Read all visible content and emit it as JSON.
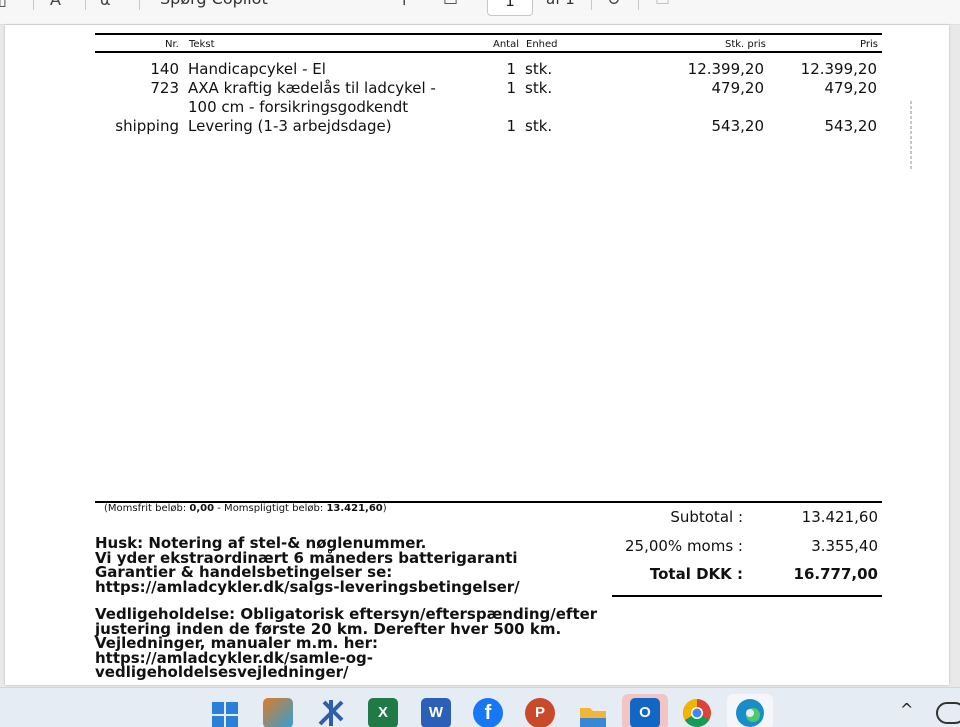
{
  "toolbar": {
    "copilot_label": "Spørg Copilot",
    "page_number": "1",
    "page_of": "af 1",
    "icons": [
      "sidebar-icon",
      "text-icon",
      "read-aloud-icon",
      "draw-icon",
      "fit-page-icon",
      "rotate-icon",
      "page-view-icon"
    ]
  },
  "invoice": {
    "columns": {
      "nr": "Nr.",
      "tekst": "Tekst",
      "antal": "Antal",
      "enhed": "Enhed",
      "stk_pris": "Stk. pris",
      "pris": "Pris"
    },
    "rows": [
      {
        "nr": "140",
        "tekst": "Handicapcykel - El",
        "tekst2": "",
        "antal": "1",
        "enhed": "stk.",
        "stk_pris": "12.399,20",
        "pris": "12.399,20"
      },
      {
        "nr": "723",
        "tekst": "AXA kraftig kædelås til ladcykel -",
        "tekst2": "100 cm - forsikringsgodkendt",
        "antal": "1",
        "enhed": "stk.",
        "stk_pris": "479,20",
        "pris": "479,20"
      },
      {
        "nr": "shipping",
        "tekst": "Levering (1-3 arbejdsdage)",
        "tekst2": "",
        "antal": "1",
        "enhed": "stk.",
        "stk_pris": "543,20",
        "pris": "543,20"
      }
    ],
    "moms_note": {
      "prefix": "(Momsfrit beløb: ",
      "momsfrit": "0,00",
      "middle": " - Momspligtigt beløb: ",
      "momspligtigt": "13.421,60",
      "suffix": ")"
    },
    "totals": {
      "subtotal_label": "Subtotal :",
      "subtotal_value": "13.421,60",
      "moms_label": "25,00% moms :",
      "moms_value": "3.355,40",
      "total_label": "Total DKK :",
      "total_value": "16.777,00"
    },
    "notes1": [
      "Husk: Notering af stel-& nøglenummer.",
      "Vi yder ekstraordinært 6 måneders batterigaranti",
      "Garantier & handelsbetingelser se:",
      "https://amladcykler.dk/salgs-leveringsbetingelser/"
    ],
    "notes2": [
      "Vedligeholdelse: Obligatorisk eftersyn/efterspænding/efter",
      "justering inden de første 20 km. Derefter hver 500 km.",
      "Vejledninger, manualer m.m. her:",
      "https://amladcykler.dk/samle-og-",
      "vedligeholdelsesvejledninger/"
    ]
  },
  "taskbar": {
    "apps": [
      {
        "name": "start-icon",
        "color": "#2a7fd9"
      },
      {
        "name": "paint-app-icon",
        "color": "#e07a26"
      },
      {
        "name": "tools-app-icon",
        "color": "#2f5fa8"
      },
      {
        "name": "excel-icon",
        "color": "#1f7a45",
        "glyph": "X"
      },
      {
        "name": "word-icon",
        "color": "#2b5fb8",
        "glyph": "W"
      },
      {
        "name": "facebook-icon",
        "color": "#1877f2",
        "glyph": "f"
      },
      {
        "name": "powerpoint-icon",
        "color": "#c94a2a",
        "glyph": "P"
      },
      {
        "name": "file-explorer-icon",
        "color": "#f2b632"
      },
      {
        "name": "outlook-icon",
        "color": "#1267c4",
        "glyph": "O"
      },
      {
        "name": "chrome-icon",
        "color": "#db4437"
      },
      {
        "name": "edge-icon",
        "color": "#1a8cc9"
      }
    ]
  }
}
